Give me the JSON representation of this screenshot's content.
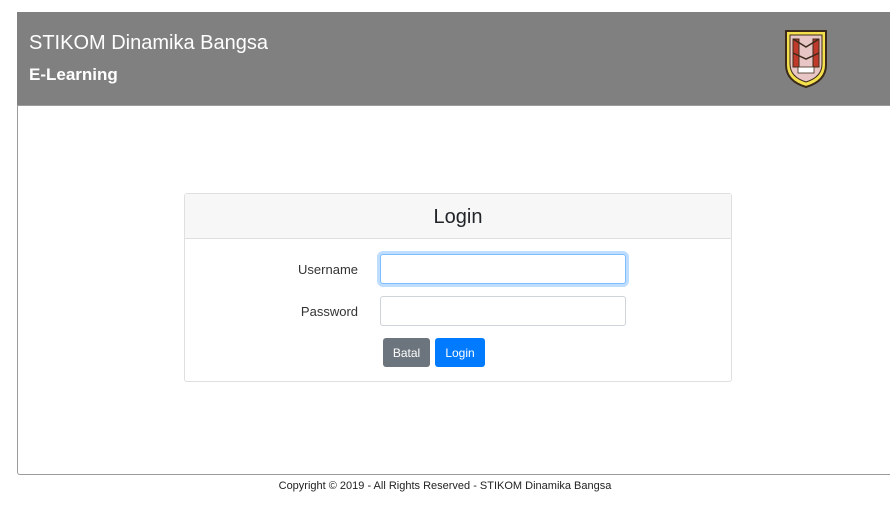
{
  "header": {
    "title": "STIKOM Dinamika Bangsa",
    "subtitle": "E-Learning",
    "logo_icon": "stikom-crest-icon",
    "background": "#808080"
  },
  "login": {
    "heading": "Login",
    "username_label": "Username",
    "username_value": "",
    "password_label": "Password",
    "password_value": "",
    "cancel_label": "Batal",
    "submit_label": "Login",
    "cancel_color": "#6c757d",
    "submit_color": "#007bff"
  },
  "footer": {
    "text": "Copyright © 2019 - All Rights Reserved - STIKOM Dinamika Bangsa"
  }
}
